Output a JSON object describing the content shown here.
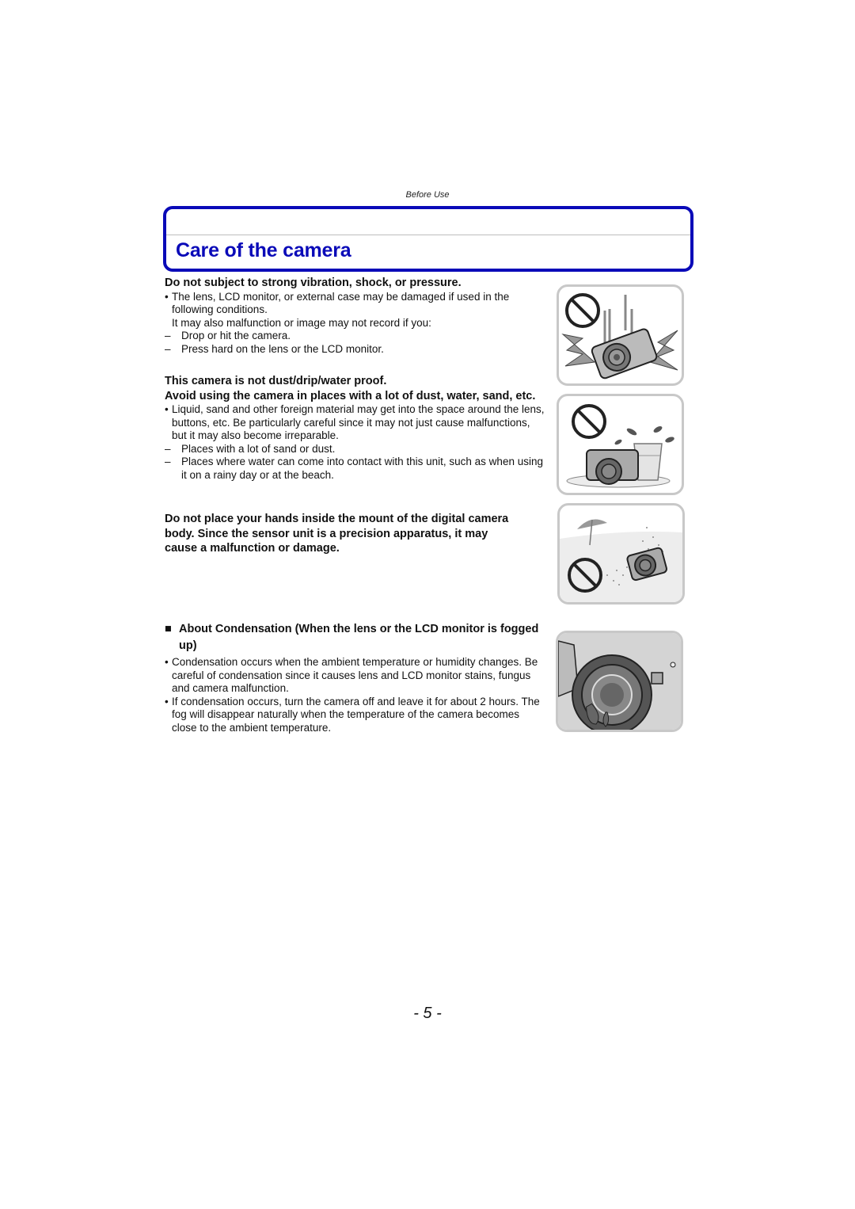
{
  "header": {
    "section_label": "Before Use",
    "title": "Care of the camera"
  },
  "colors": {
    "title_blue": "#0a0ab8",
    "divider_gray": "#bdbdbd",
    "illustration_border": "#c8c8c8"
  },
  "sections": {
    "vibration": {
      "heading": "Do not subject to strong vibration, shock, or pressure.",
      "bullet_mark": "•",
      "bullet": "The lens, LCD monitor, or external case may be damaged if used in the following conditions.",
      "sub": "It may also malfunction or image may not record if you:",
      "dash_mark": "–",
      "dashes": [
        "Drop or hit the camera.",
        "Press hard on the lens or the LCD monitor."
      ]
    },
    "dust": {
      "heading_1": "This camera is not dust/drip/water proof.",
      "heading_2": "Avoid using the camera in places with a lot of dust, water, sand, etc.",
      "bullet_mark": "•",
      "bullet": "Liquid, sand and other foreign material may get into the space around the lens, buttons, etc. Be particularly careful since it may not just cause malfunctions, but it may also become irreparable.",
      "dash_mark": "–",
      "dashes": [
        "Places with a lot of sand or dust.",
        "Places where water can come into contact with this unit, such as when using it on a rainy day or at the beach."
      ]
    },
    "mount": {
      "heading": "Do not place your hands inside the mount of the digital camera body. Since the sensor unit is a precision apparatus, it may cause a malfunction or damage."
    },
    "condensation": {
      "square_mark": "■",
      "heading": "About Condensation (When the lens or the LCD monitor is fogged up)",
      "bullet_mark": "•",
      "bullets": [
        "Condensation occurs when the ambient temperature or humidity changes. Be careful of condensation since it causes lens and LCD monitor stains, fungus and camera malfunction.",
        "If condensation occurs, turn the camera off and leave it for about 2 hours. The fog will disappear naturally when the temperature of the camera becomes close to the ambient temperature."
      ]
    }
  },
  "illustrations": [
    {
      "icon": "camera-drop-prohibited-illustration"
    },
    {
      "icon": "camera-water-prohibited-illustration"
    },
    {
      "icon": "camera-sand-prohibited-illustration"
    },
    {
      "icon": "lens-condensation-illustration"
    }
  ],
  "footer": {
    "page_number": "- 5 -"
  }
}
